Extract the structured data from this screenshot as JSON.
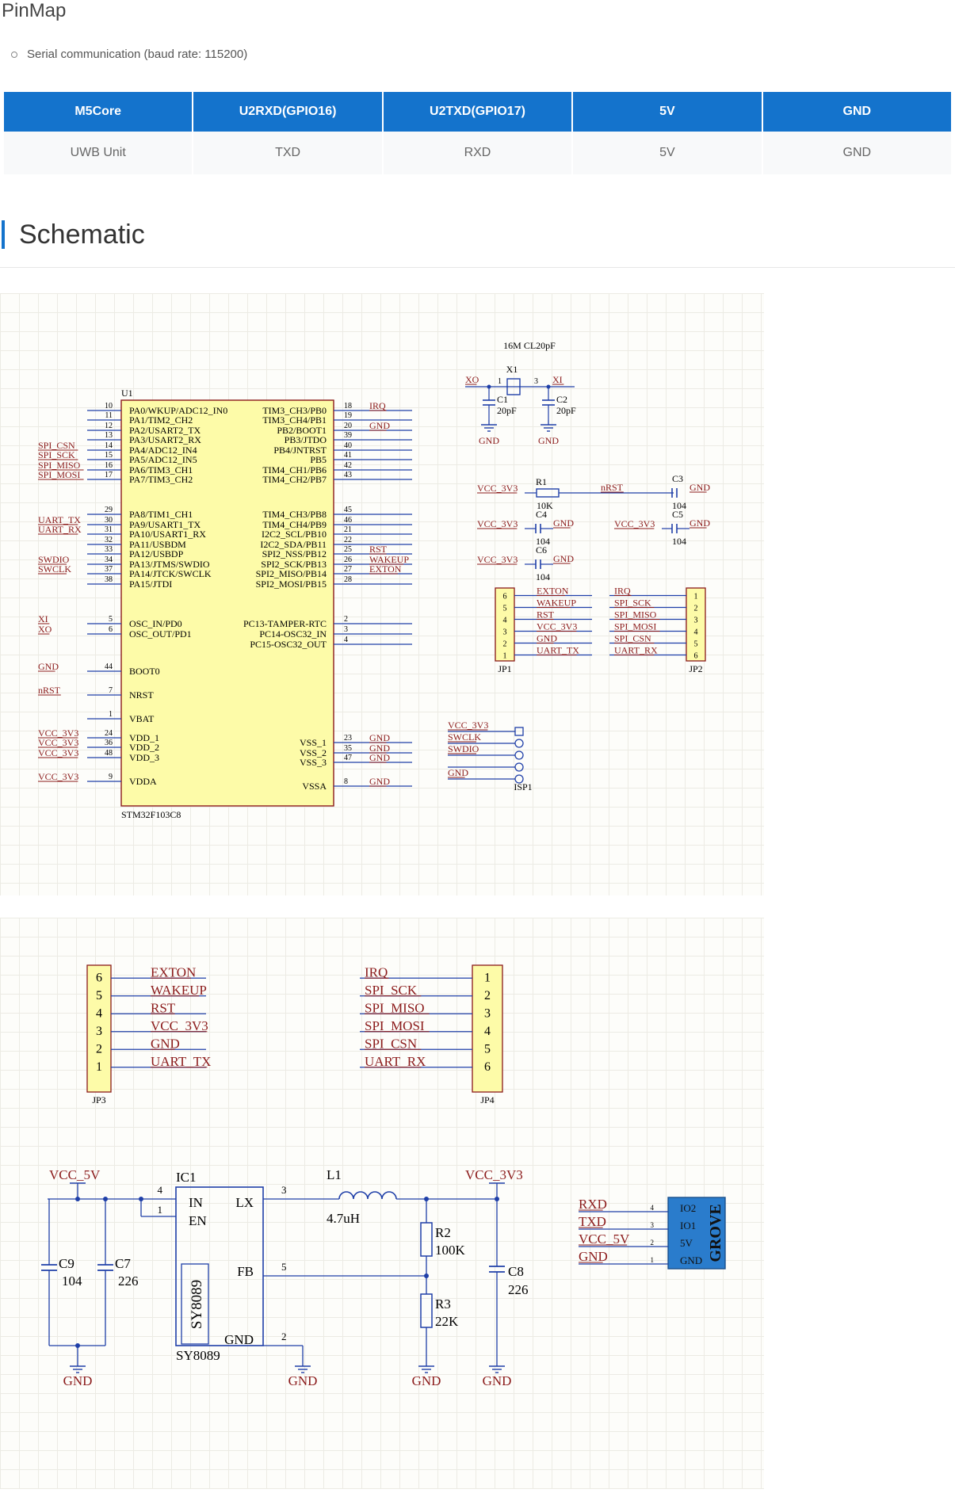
{
  "pinmap": {
    "title": "PinMap",
    "note": "Serial communication (baud rate: 115200)",
    "headers": [
      "M5Core",
      "U2RXD(GPIO16)",
      "U2TXD(GPIO17)",
      "5V",
      "GND"
    ],
    "row": [
      "UWB Unit",
      "TXD",
      "RXD",
      "5V",
      "GND"
    ]
  },
  "schematic": {
    "title": "Schematic",
    "mcu": {
      "designator": "U1",
      "part": "STM32F103C8",
      "left_pins": [
        {
          "name": "PA0/WKUP/ADC12_IN0",
          "num": "10",
          "net": ""
        },
        {
          "name": "PA1/TIM2_CH2",
          "num": "11",
          "net": ""
        },
        {
          "name": "PA2/USART2_TX",
          "num": "12",
          "net": ""
        },
        {
          "name": "PA3/USART2_RX",
          "num": "13",
          "net": ""
        },
        {
          "name": "PA4/ADC12_IN4",
          "num": "14",
          "net": "SPI_CSN"
        },
        {
          "name": "PA5/ADC12_IN5",
          "num": "15",
          "net": "SPI_SCK"
        },
        {
          "name": "PA6/TIM3_CH1",
          "num": "16",
          "net": "SPI_MISO"
        },
        {
          "name": "PA7/TIM3_CH2",
          "num": "17",
          "net": "SPI_MOSI"
        },
        {
          "name": "PA8/TIM1_CH1",
          "num": "29",
          "net": ""
        },
        {
          "name": "PA9/USART1_TX",
          "num": "30",
          "net": "UART_TX"
        },
        {
          "name": "PA10/USART1_RX",
          "num": "31",
          "net": "UART_RX"
        },
        {
          "name": "PA11/USBDM",
          "num": "32",
          "net": ""
        },
        {
          "name": "PA12/USBDP",
          "num": "33",
          "net": ""
        },
        {
          "name": "PA13/JTMS/SWDIO",
          "num": "34",
          "net": "SWDIO"
        },
        {
          "name": "PA14/JTCK/SWCLK",
          "num": "37",
          "net": "SWCLK"
        },
        {
          "name": "PA15/JTDI",
          "num": "38",
          "net": ""
        },
        {
          "name": "OSC_IN/PD0",
          "num": "5",
          "net": "XI"
        },
        {
          "name": "OSC_OUT/PD1",
          "num": "6",
          "net": "XO"
        },
        {
          "name": "BOOT0",
          "num": "44",
          "net": "GND"
        },
        {
          "name": "NRST",
          "num": "7",
          "net": "nRST"
        },
        {
          "name": "VBAT",
          "num": "1",
          "net": ""
        },
        {
          "name": "VDD_1",
          "num": "24",
          "net": "VCC_3V3"
        },
        {
          "name": "VDD_2",
          "num": "36",
          "net": "VCC_3V3"
        },
        {
          "name": "VDD_3",
          "num": "48",
          "net": "VCC_3V3"
        },
        {
          "name": "VDDA",
          "num": "9",
          "net": "VCC_3V3"
        }
      ],
      "right_pins": [
        {
          "name": "TIM3_CH3/PB0",
          "num": "18",
          "net": "IRQ"
        },
        {
          "name": "TIM3_CH4/PB1",
          "num": "19",
          "net": ""
        },
        {
          "name": "PB2/BOOT1",
          "num": "20",
          "net": "GND"
        },
        {
          "name": "PB3/JTDO",
          "num": "39",
          "net": ""
        },
        {
          "name": "PB4/JNTRST",
          "num": "40",
          "net": ""
        },
        {
          "name": "PB5",
          "num": "41",
          "net": ""
        },
        {
          "name": "TIM4_CH1/PB6",
          "num": "42",
          "net": ""
        },
        {
          "name": "TIM4_CH2/PB7",
          "num": "43",
          "net": ""
        },
        {
          "name": "TIM4_CH3/PB8",
          "num": "45",
          "net": ""
        },
        {
          "name": "TIM4_CH4/PB9",
          "num": "46",
          "net": ""
        },
        {
          "name": "I2C2_SCL/PB10",
          "num": "21",
          "net": ""
        },
        {
          "name": "I2C2_SDA/PB11",
          "num": "22",
          "net": ""
        },
        {
          "name": "SPI2_NSS/PB12",
          "num": "25",
          "net": "RST"
        },
        {
          "name": "SPI2_SCK/PB13",
          "num": "26",
          "net": "WAKEUP"
        },
        {
          "name": "SPI2_MISO/PB14",
          "num": "27",
          "net": "EXTON"
        },
        {
          "name": "SPI2_MOSI/PB15",
          "num": "28",
          "net": ""
        },
        {
          "name": "PC13-TAMPER-RTC",
          "num": "2",
          "net": ""
        },
        {
          "name": "PC14-OSC32_IN",
          "num": "3",
          "net": ""
        },
        {
          "name": "PC15-OSC32_OUT",
          "num": "4",
          "net": ""
        },
        {
          "name": "VSS_1",
          "num": "23",
          "net": "GND"
        },
        {
          "name": "VSS_2",
          "num": "35",
          "net": "GND"
        },
        {
          "name": "VSS_3",
          "num": "47",
          "net": "GND"
        },
        {
          "name": "VSSA",
          "num": "8",
          "net": "GND"
        }
      ]
    },
    "crystal": {
      "label": "16M CL20pF",
      "designator": "X1",
      "xo": "XO",
      "xi": "XI",
      "pin1": "1",
      "pin3": "3",
      "c1": "C1",
      "c1v": "20pF",
      "c2": "C2",
      "c2v": "20pF",
      "gnd": "GND"
    },
    "rc": {
      "r1": "R1",
      "r1v": "10K",
      "nrst": "nRST",
      "c3": "C3",
      "c3v": "104",
      "c4": "C4",
      "c4v": "104",
      "c5": "C5",
      "c5v": "104",
      "c6": "C6",
      "c6v": "104",
      "vcc": "VCC_3V3",
      "gnd": "GND"
    },
    "jp1": {
      "designator": "JP1",
      "nums": [
        "6",
        "5",
        "4",
        "3",
        "2",
        "1"
      ],
      "nets": [
        "EXTON",
        "WAKEUP",
        "RST",
        "VCC_3V3",
        "GND",
        "UART_TX"
      ]
    },
    "jp2": {
      "designator": "JP2",
      "nums": [
        "1",
        "2",
        "3",
        "4",
        "5",
        "6"
      ],
      "nets": [
        "IRQ",
        "SPI_SCK",
        "SPI_MISO",
        "SPI_MOSI",
        "SPI_CSN",
        "UART_RX"
      ]
    },
    "isp": {
      "designator": "ISP1",
      "nets": [
        "VCC_3V3",
        "SWCLK",
        "SWDIO",
        "",
        "GND"
      ]
    },
    "jp3": {
      "designator": "JP3",
      "nums": [
        "6",
        "5",
        "4",
        "3",
        "2",
        "1"
      ],
      "nets": [
        "EXTON",
        "WAKEUP",
        "RST",
        "VCC_3V3",
        "GND",
        "UART_TX"
      ]
    },
    "jp4": {
      "designator": "JP4",
      "nums": [
        "1",
        "2",
        "3",
        "4",
        "5",
        "6"
      ],
      "nets": [
        "IRQ",
        "SPI_SCK",
        "SPI_MISO",
        "SPI_MOSI",
        "SPI_CSN",
        "UART_RX"
      ]
    },
    "power": {
      "vin": "VCC_5V",
      "vout": "VCC_3V3",
      "ic": "IC1",
      "ic_part": "SY8089",
      "ic_body": "SY8089",
      "in": "IN",
      "en": "EN",
      "lx": "LX",
      "fb": "FB",
      "gnd_pin": "GND",
      "pin4": "4",
      "pin1": "1",
      "pin3": "3",
      "pin5": "5",
      "pin2": "2",
      "l1": "L1",
      "l1v": "4.7uH",
      "r2": "R2",
      "r2v": "100K",
      "r3": "R3",
      "r3v": "22K",
      "c9": "C9",
      "c9v": "104",
      "c7": "C7",
      "c7v": "226",
      "c8": "C8",
      "c8v": "226",
      "gnd": "GND"
    },
    "grove": {
      "logo": "GROVE",
      "nets": [
        "RXD",
        "TXD",
        "VCC_5V",
        "GND"
      ],
      "nums": [
        "4",
        "3",
        "2",
        "1"
      ],
      "pins": [
        "IO2",
        "IO1",
        "5V",
        "GND"
      ]
    }
  }
}
